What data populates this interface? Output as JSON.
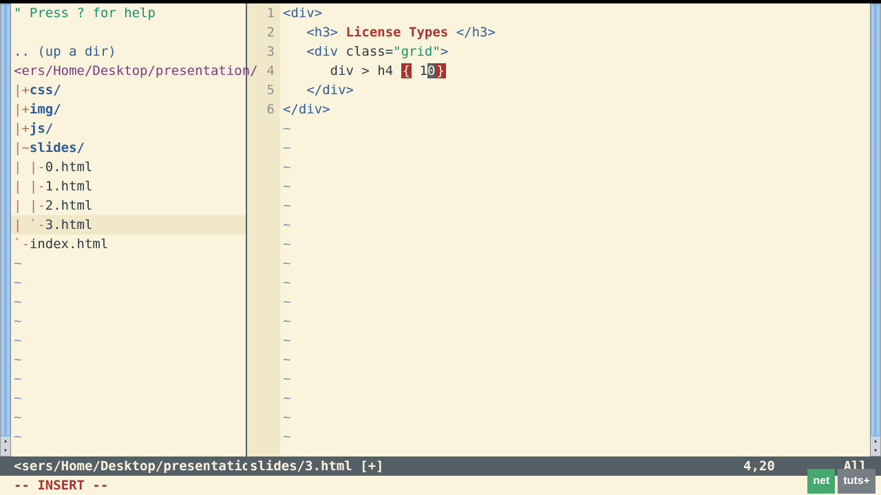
{
  "tree": {
    "help": "\" Press ? for help",
    "blank": " ",
    "updir": ".. (up a dir)",
    "path": "<ers/Home/Desktop/presentation/",
    "items": [
      {
        "branch": "|+",
        "label": "css/",
        "kind": "dir"
      },
      {
        "branch": "|+",
        "label": "img/",
        "kind": "dir"
      },
      {
        "branch": "|+",
        "label": "js/",
        "kind": "dir"
      },
      {
        "branch": "|~",
        "label": "slides/",
        "kind": "dir"
      },
      {
        "branch": "| |-",
        "label": "0.html",
        "kind": "file"
      },
      {
        "branch": "| |-",
        "label": "1.html",
        "kind": "file"
      },
      {
        "branch": "| |-",
        "label": "2.html",
        "kind": "file"
      },
      {
        "branch": "| `-",
        "label": "3.html",
        "kind": "file",
        "current": true
      },
      {
        "branch": "`-",
        "label": "index.html",
        "kind": "file"
      }
    ]
  },
  "code": {
    "lines": [
      {
        "n": "1",
        "segs": [
          {
            "t": "<div>",
            "c": "tag"
          }
        ]
      },
      {
        "n": "2",
        "segs": [
          {
            "t": "   ",
            "c": "plain"
          },
          {
            "t": "<h3>",
            "c": "tag"
          },
          {
            "t": " License Types ",
            "c": "txt"
          },
          {
            "t": "</h3>",
            "c": "tag"
          }
        ]
      },
      {
        "n": "3",
        "segs": [
          {
            "t": "   ",
            "c": "plain"
          },
          {
            "t": "<div ",
            "c": "tag"
          },
          {
            "t": "class=",
            "c": "attr"
          },
          {
            "t": "\"grid\"",
            "c": "str"
          },
          {
            "t": ">",
            "c": "tag"
          }
        ]
      },
      {
        "n": "4",
        "segs": [
          {
            "t": "      div > h4 ",
            "c": "plain"
          },
          {
            "t": "{",
            "c": "brace"
          },
          {
            "t": " 1",
            "c": "plain"
          },
          {
            "t": "0",
            "c": "cursorchar"
          },
          {
            "t": "}",
            "c": "brace"
          }
        ]
      },
      {
        "n": "5",
        "segs": [
          {
            "t": "   ",
            "c": "plain"
          },
          {
            "t": "</div>",
            "c": "tag"
          }
        ]
      },
      {
        "n": "6",
        "segs": [
          {
            "t": "</div>",
            "c": "tag"
          }
        ]
      }
    ]
  },
  "status": {
    "left": "<sers/Home/Desktop/presentation ",
    "file": "slides/3.html [+]",
    "pos": "4,20",
    "all": "All",
    "mode": "-- INSERT --"
  },
  "logo": {
    "a": "net",
    "b": "tuts+"
  }
}
